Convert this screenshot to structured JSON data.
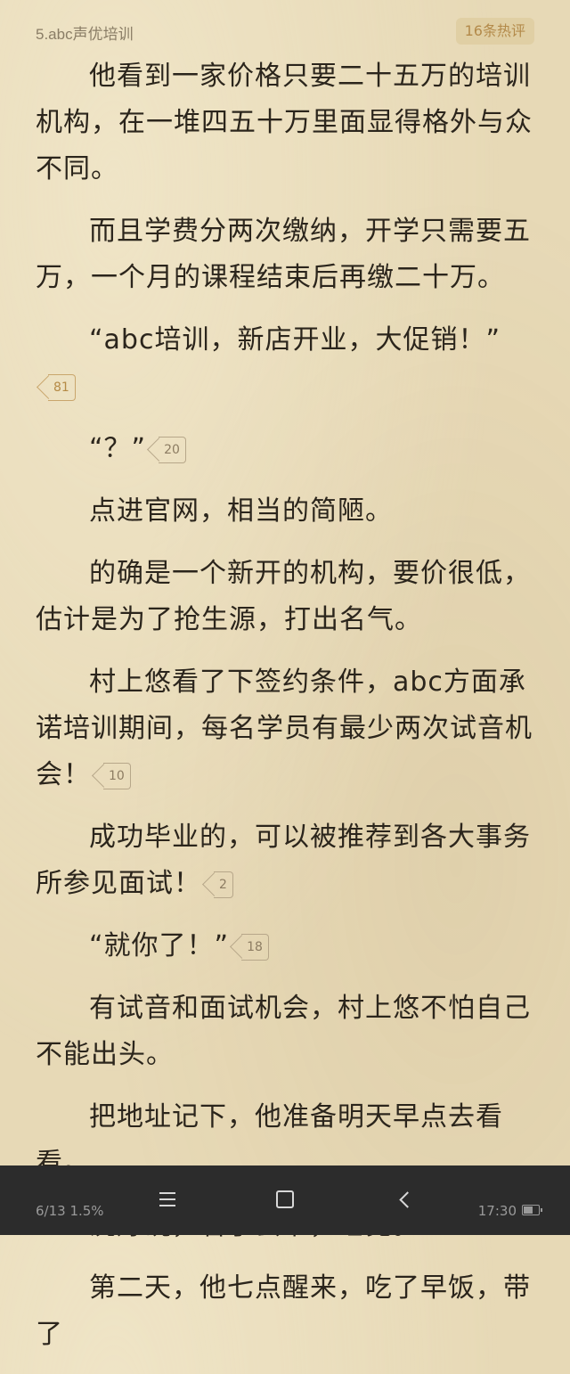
{
  "header": {
    "chapter_title": "5.abc声优培训",
    "hot_comments": "16条热评"
  },
  "paragraphs": [
    {
      "text": "他看到一家价格只要二十五万的培训机构，在一堆四五十万里面显得格外与众不同。",
      "comment_count": null
    },
    {
      "text": "而且学费分两次缴纳，开学只需要五万，一个月的课程结束后再缴二十万。",
      "comment_count": null
    },
    {
      "text": "“abc培训，新店开业，大促销！”",
      "comment_count": "81",
      "hot": true
    },
    {
      "text": "“？”",
      "comment_count": "20",
      "hot": false
    },
    {
      "text": "点进官网，相当的简陋。",
      "comment_count": null
    },
    {
      "text": "的确是一个新开的机构，要价很低，估计是为了抢生源，打出名气。",
      "comment_count": null
    },
    {
      "text": "村上悠看了下签约条件，abc方面承诺培训期间，每名学员有最少两次试音机会！",
      "comment_count": "10",
      "hot": false
    },
    {
      "text": "成功毕业的，可以被推荐到各大事务所参见面试！",
      "comment_count": "2",
      "hot": false
    },
    {
      "text": "“就你了！”",
      "comment_count": "18",
      "hot": false
    },
    {
      "text": "有试音和面试机会，村上悠不怕自己不能出头。",
      "comment_count": null
    },
    {
      "text": "把地址记下，他准备明天早点去看看。",
      "comment_count": null
    },
    {
      "text": "洗好碗，看了会书，睡觉。",
      "comment_count": null
    },
    {
      "text": "第二天，他七点醒来，吃了早饭，带了",
      "comment_count": null
    }
  ],
  "status_bar": {
    "progress": "6/13  1.5%",
    "time": "17:30",
    "battery_level": 0.6
  },
  "nav": {
    "menu_icon": "menu-icon",
    "home_icon": "home-icon",
    "back_icon": "back-icon"
  },
  "colors": {
    "page_background": "#e7d9b6",
    "text": "#2b251c",
    "hot_badge": "#b58a45",
    "status_bar": "#2c2c2c"
  }
}
